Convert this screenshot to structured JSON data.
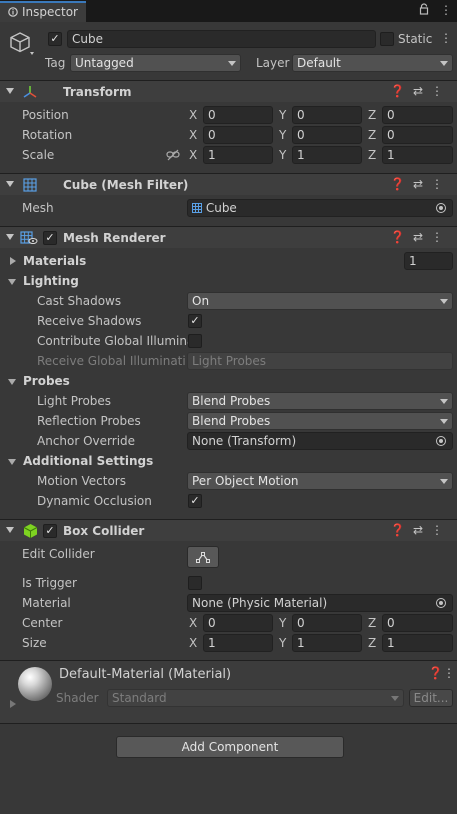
{
  "tab": {
    "title": "Inspector"
  },
  "object": {
    "name": "Cube",
    "static_label": "Static",
    "tag_label": "Tag",
    "tag_value": "Untagged",
    "layer_label": "Layer",
    "layer_value": "Default"
  },
  "transform": {
    "title": "Transform",
    "position_label": "Position",
    "rotation_label": "Rotation",
    "scale_label": "Scale",
    "axis_x": "X",
    "axis_y": "Y",
    "axis_z": "Z",
    "position": [
      "0",
      "0",
      "0"
    ],
    "rotation": [
      "0",
      "0",
      "0"
    ],
    "scale": [
      "1",
      "1",
      "1"
    ]
  },
  "mesh_filter": {
    "title": "Cube (Mesh Filter)",
    "mesh_label": "Mesh",
    "mesh_value": "Cube"
  },
  "mesh_renderer": {
    "title": "Mesh Renderer",
    "materials_label": "Materials",
    "materials_count": "1",
    "lighting_label": "Lighting",
    "cast_shadows_label": "Cast Shadows",
    "cast_shadows_value": "On",
    "receive_shadows_label": "Receive Shadows",
    "contribute_gi_label": "Contribute Global Illuminat",
    "receive_gi_label": "Receive Global Illuminatior",
    "receive_gi_value": "Light Probes",
    "probes_label": "Probes",
    "light_probes_label": "Light Probes",
    "light_probes_value": "Blend Probes",
    "reflection_probes_label": "Reflection Probes",
    "reflection_probes_value": "Blend Probes",
    "anchor_override_label": "Anchor Override",
    "anchor_override_value": "None (Transform)",
    "additional_label": "Additional Settings",
    "motion_vectors_label": "Motion Vectors",
    "motion_vectors_value": "Per Object Motion",
    "dynamic_occlusion_label": "Dynamic Occlusion"
  },
  "box_collider": {
    "title": "Box Collider",
    "edit_collider_label": "Edit Collider",
    "is_trigger_label": "Is Trigger",
    "material_label": "Material",
    "material_value": "None (Physic Material)",
    "center_label": "Center",
    "size_label": "Size",
    "center": [
      "0",
      "0",
      "0"
    ],
    "size": [
      "1",
      "1",
      "1"
    ]
  },
  "material": {
    "title": "Default-Material (Material)",
    "shader_label": "Shader",
    "shader_value": "Standard",
    "edit_label": "Edit..."
  },
  "add_component_label": "Add Component",
  "colors": {
    "background": "#383838",
    "header": "#3e3e3e",
    "field": "#2a2a2a",
    "tab_accent": "#3a79bb",
    "box_collider_icon": "#7ed321"
  }
}
